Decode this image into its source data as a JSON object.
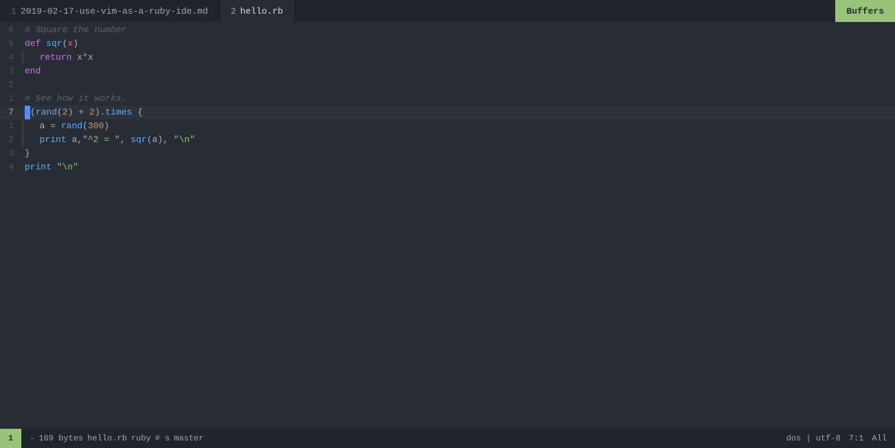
{
  "tabs": [
    {
      "id": "tab1",
      "number": "1",
      "label": "2019-02-17-use-vim-as-a-ruby-ide.md",
      "active": false
    },
    {
      "id": "tab2",
      "number": "2",
      "label": "hello.rb",
      "active": true
    }
  ],
  "buffers_label": "Buffers",
  "code_lines": [
    {
      "num": "6",
      "content": "# Square the number",
      "type": "comment"
    },
    {
      "num": "5",
      "content": "def sqr(x)",
      "type": "code"
    },
    {
      "num": "4",
      "content": "  return x*x",
      "type": "code",
      "indent": true
    },
    {
      "num": "3",
      "content": "end",
      "type": "code"
    },
    {
      "num": "2",
      "content": "",
      "type": "empty"
    },
    {
      "num": "1",
      "content": "# See how it works.",
      "type": "comment"
    },
    {
      "num": "7",
      "content": "(rand(2) + 2).times {",
      "type": "code",
      "current": true
    },
    {
      "num": "1",
      "content": "  a = rand(300)",
      "type": "code",
      "indent": true
    },
    {
      "num": "2",
      "content": "  print a,\"^2 = \", sqr(a), \"\\n\"",
      "type": "code",
      "indent": true
    },
    {
      "num": "3",
      "content": "}",
      "type": "code"
    },
    {
      "num": "4",
      "content": "print \"\\n\"",
      "type": "code"
    }
  ],
  "status": {
    "mode": "1",
    "dash": "-",
    "bytes": "169 bytes",
    "filename": "hello.rb",
    "filetype": "ruby",
    "flag": "# s",
    "branch": "master",
    "encoding": "dos | utf-8",
    "position": "7:1",
    "scroll": "All"
  }
}
